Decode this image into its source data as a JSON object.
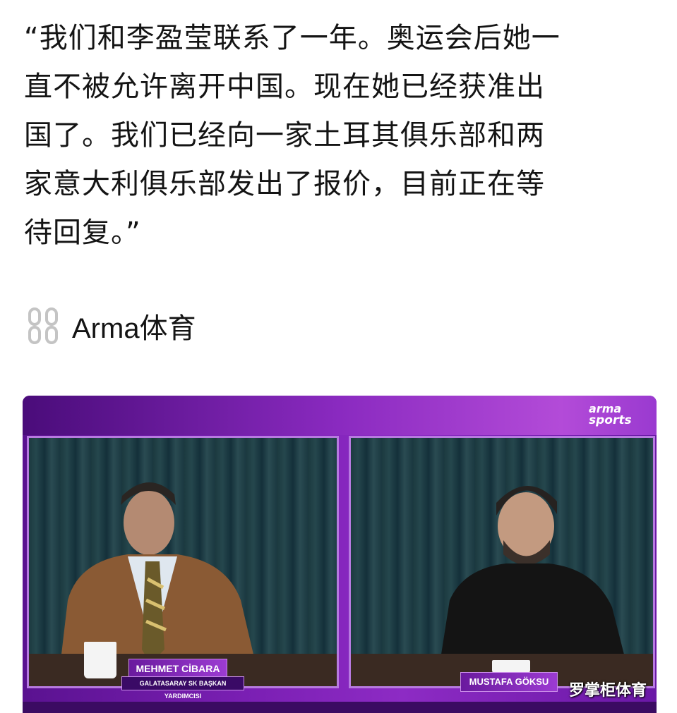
{
  "post": {
    "quote_lines": [
      "“我们和李盈莹联系了一年。奥运会后她一",
      "直不被允许离开中国。现在她已经获准出",
      "国了。我们已经向一家土耳其俱乐部和两",
      "家意大利俱乐部发出了报价，目前正在等",
      "待回复。”"
    ],
    "source_icon": "chain-link-icon",
    "source_label": "Arma体育"
  },
  "video": {
    "logo_line1": "arma",
    "logo_line2": "sports",
    "left_name": "MEHMET CİBARA",
    "left_title": "GALATASARAY SK BAŞKAN YARDIMCISI",
    "right_name": "MUSTAFA GÖKSU",
    "watermark": "罗掌柜体育"
  },
  "colors": {
    "brand_purple": "#7a1fb3",
    "text": "#141414"
  }
}
